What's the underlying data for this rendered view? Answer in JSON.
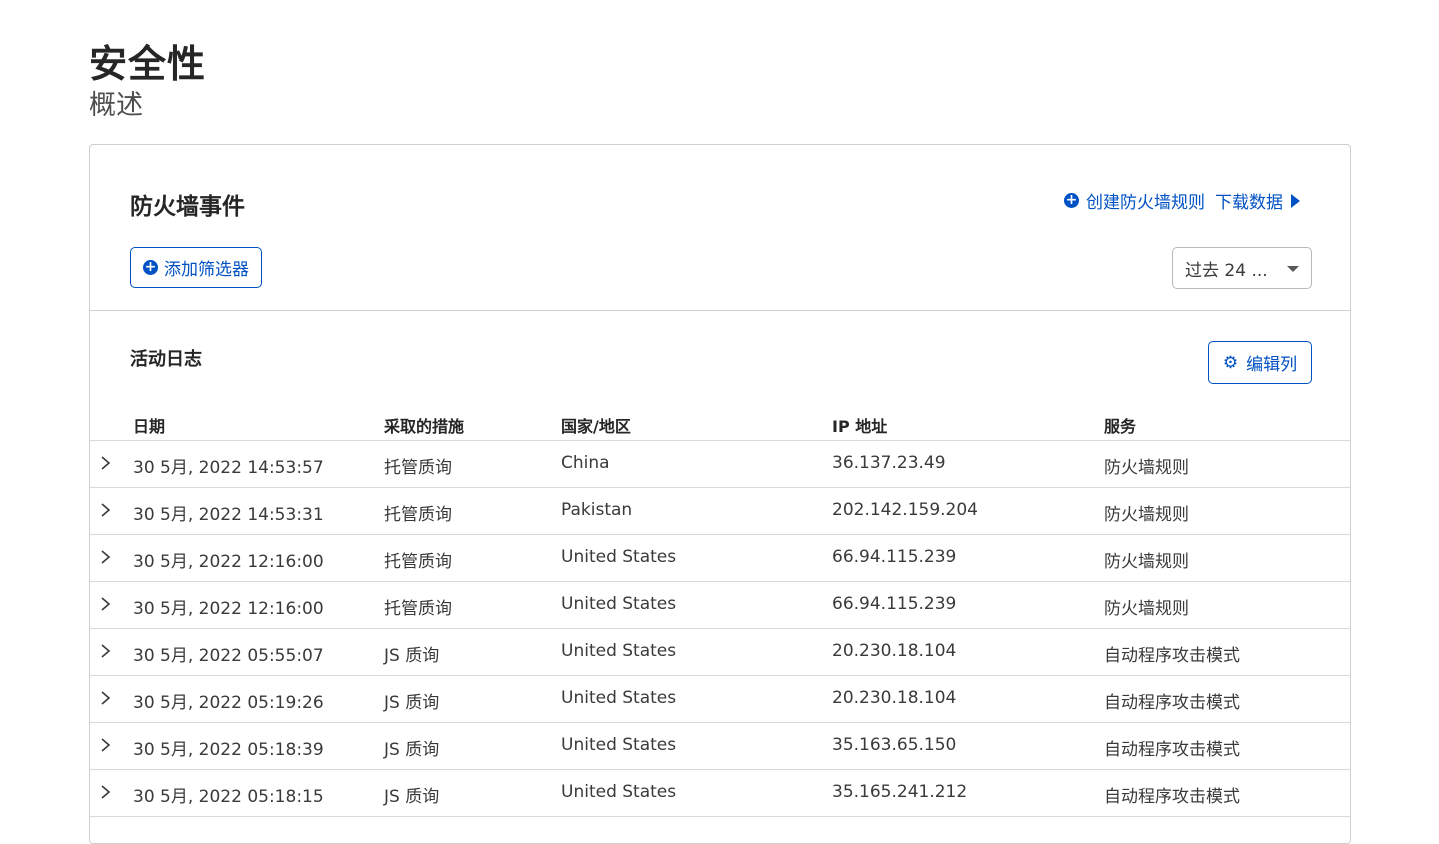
{
  "page": {
    "title": "安全性",
    "subtitle": "概述"
  },
  "firewall": {
    "title": "防火墙事件",
    "create_rule_label": "创建防火墙规则",
    "download_label": "下载数据",
    "add_filter_label": "添加筛选器",
    "time_range_value": "过去 24 ..."
  },
  "activity_log": {
    "title": "活动日志",
    "edit_columns_label": "编辑列",
    "columns": [
      "日期",
      "采取的措施",
      "国家/地区",
      "IP 地址",
      "服务"
    ],
    "rows": [
      [
        "30 5月, 2022 14:53:57",
        "托管质询",
        "China",
        "36.137.23.49",
        "防火墙规则"
      ],
      [
        "30 5月, 2022 14:53:31",
        "托管质询",
        "Pakistan",
        "202.142.159.204",
        "防火墙规则"
      ],
      [
        "30 5月, 2022 12:16:00",
        "托管质询",
        "United States",
        "66.94.115.239",
        "防火墙规则"
      ],
      [
        "30 5月, 2022 12:16:00",
        "托管质询",
        "United States",
        "66.94.115.239",
        "防火墙规则"
      ],
      [
        "30 5月, 2022 05:55:07",
        "JS 质询",
        "United States",
        "20.230.18.104",
        "自动程序攻击模式"
      ],
      [
        "30 5月, 2022 05:19:26",
        "JS 质询",
        "United States",
        "20.230.18.104",
        "自动程序攻击模式"
      ],
      [
        "30 5月, 2022 05:18:39",
        "JS 质询",
        "United States",
        "35.163.65.150",
        "自动程序攻击模式"
      ],
      [
        "30 5月, 2022 05:18:15",
        "JS 质询",
        "United States",
        "35.165.241.212",
        "自动程序攻击模式"
      ]
    ]
  },
  "colors": {
    "accent": "#0051c3",
    "border": "#cfcfcf",
    "text": "#313131"
  },
  "icons": {
    "add": "plus-circle-icon",
    "download": "caret-right-icon",
    "settings": "gear-icon",
    "expand": "chevron-right-icon",
    "dropdown": "caret-down-icon"
  }
}
